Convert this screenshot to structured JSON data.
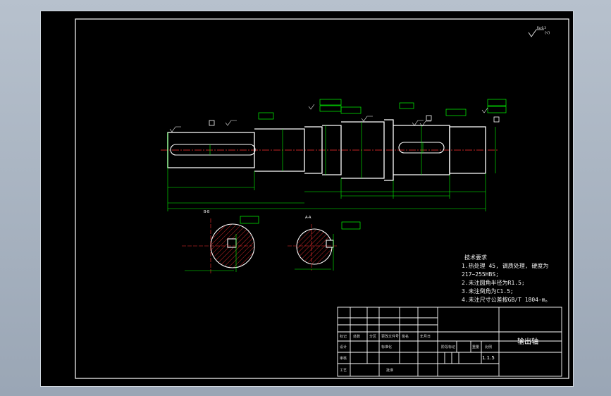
{
  "drawing": {
    "part_name": "输出轴",
    "drawing_number": "1.1.5",
    "notes_title": "技术要求",
    "notes": [
      "1.热处理 45, 调质处理, 硬度为",
      "217~255HBS;",
      "2.未注圆角半径为R1.5;",
      "3.未注倒角为C1.5;",
      "4.未注尺寸公差按GB/T 1804-m。"
    ],
    "section_labels": [
      "B-B",
      "A-A"
    ],
    "title_block_cells": [
      "标记",
      "处数",
      "分区",
      "更改文件号",
      "签名",
      "年月日",
      "设计",
      "标准化",
      "阶段标记",
      "重量",
      "比例",
      "审核",
      "工艺",
      "批准"
    ],
    "colors": {
      "outline": "#ffffff",
      "dimension": "#00ff00",
      "centerline": "#ff3030",
      "hatch": "#ff3030",
      "text": "#ffffff"
    }
  }
}
